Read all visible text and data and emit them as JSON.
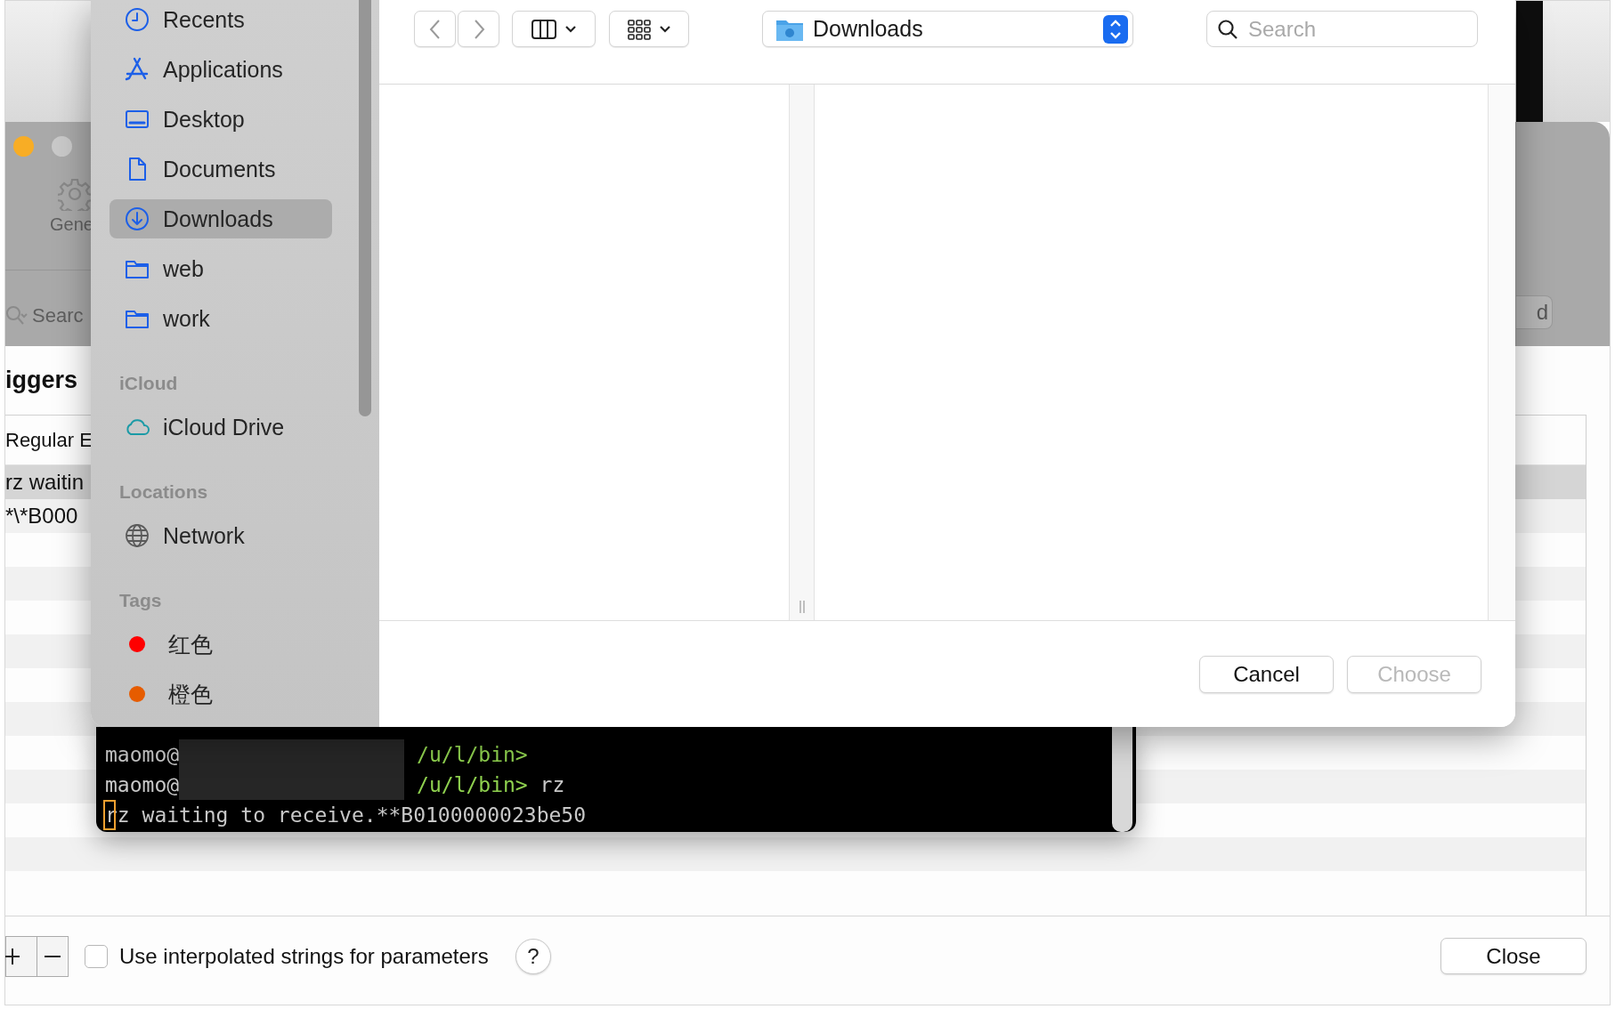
{
  "background_window": {
    "settings": {
      "tab_label": "Gene",
      "search_placeholder": "Searc",
      "button_label": "d"
    },
    "heading": "iggers",
    "table": {
      "columns": [
        "Regular E"
      ],
      "rows": [
        {
          "cells": [
            "rz waitin"
          ],
          "selected": true
        },
        {
          "cells": [
            "*\\*B000"
          ],
          "selected": false
        }
      ]
    },
    "footer": {
      "checkbox": {
        "label": "Use interpolated strings for parameters",
        "checked": false
      },
      "help_label": "?",
      "close_label": "Close"
    }
  },
  "terminal": {
    "lines": [
      {
        "kind": "prompt",
        "user": "maomo@",
        "path": "/u/l/bin>"
      },
      {
        "kind": "prompt",
        "user": "maomo@",
        "path": "/u/l/bin>",
        "command": "rz"
      },
      {
        "kind": "output",
        "text": "rz waiting to receive.**B0100000023be50",
        "cursor": true
      }
    ]
  },
  "file_dialog": {
    "sidebar": {
      "sections": [
        {
          "items": [
            {
              "label": "Recents",
              "kind": "clock",
              "selected": false
            },
            {
              "label": "Applications",
              "kind": "apps",
              "selected": false
            },
            {
              "label": "Desktop",
              "kind": "desktop",
              "selected": false
            },
            {
              "label": "Documents",
              "kind": "document",
              "selected": false
            },
            {
              "label": "Downloads",
              "kind": "download",
              "selected": true
            },
            {
              "label": "web",
              "kind": "folder",
              "selected": false
            },
            {
              "label": "work",
              "kind": "folder",
              "selected": false
            }
          ]
        },
        {
          "header": "iCloud",
          "items": [
            {
              "label": "iCloud Drive",
              "kind": "cloud",
              "selected": false
            }
          ]
        },
        {
          "header": "Locations",
          "items": [
            {
              "label": "Network",
              "kind": "globe",
              "selected": false
            }
          ]
        },
        {
          "header": "Tags",
          "items": [
            {
              "label": "红色",
              "kind": "tag",
              "color": "#fe0000",
              "selected": false
            },
            {
              "label": "橙色",
              "kind": "tag",
              "color": "#e65c00",
              "selected": false
            }
          ]
        }
      ]
    },
    "toolbar": {
      "location": "Downloads",
      "search_placeholder": "Search"
    },
    "buttons": [
      {
        "label": "Cancel",
        "disabled": false
      },
      {
        "label": "Choose",
        "disabled": true
      }
    ]
  }
}
